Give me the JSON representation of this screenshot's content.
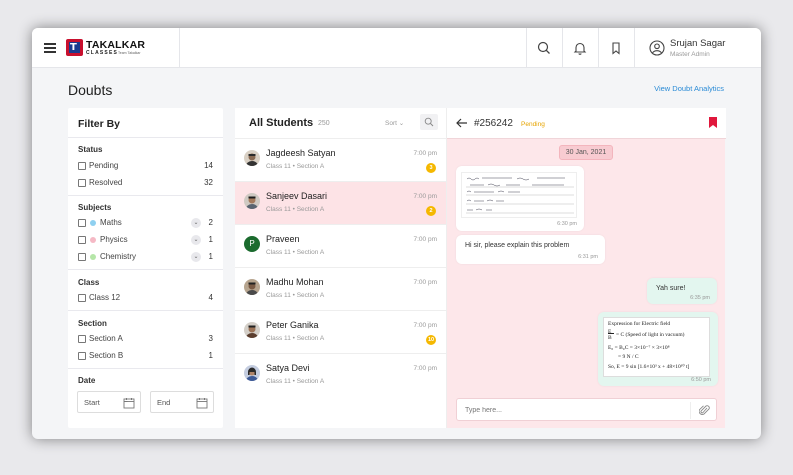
{
  "brand": {
    "name": "TAKALKAR",
    "subtitle": "CLASSES",
    "tagline": "Team Takalkar",
    "mark": "T"
  },
  "user": {
    "name": "Srujan Sagar",
    "role": "Master Admin"
  },
  "page": {
    "title": "Doubts",
    "analytics_link": "View Doubt Analytics"
  },
  "filter": {
    "title": "Filter By",
    "status": {
      "title": "Status",
      "items": [
        {
          "label": "Pending",
          "count": "14"
        },
        {
          "label": "Resolved",
          "count": "32"
        }
      ]
    },
    "subjects": {
      "title": "Subjects",
      "items": [
        {
          "label": "Maths",
          "count": "2",
          "color": "#8fd0f0"
        },
        {
          "label": "Physics",
          "count": "1",
          "color": "#f5b9c5"
        },
        {
          "label": "Chemistry",
          "count": "1",
          "color": "#b5e6a8"
        }
      ]
    },
    "class": {
      "title": "Class",
      "items": [
        {
          "label": "Class 12",
          "count": "4"
        }
      ]
    },
    "section": {
      "title": "Section",
      "items": [
        {
          "label": "Section A",
          "count": "3"
        },
        {
          "label": "Section B",
          "count": "1"
        }
      ]
    },
    "date": {
      "title": "Date",
      "start": "Start",
      "end": "End"
    }
  },
  "students": {
    "title": "All Students",
    "count": "250",
    "sort": "Sort",
    "items": [
      {
        "name": "Jagdeesh Satyan",
        "sub": "Class 11 • Section A",
        "time": "7:00 pm",
        "badge": "3"
      },
      {
        "name": "Sanjeev Dasari",
        "sub": "Class 11 • Section A",
        "time": "7:00 pm",
        "badge": "2"
      },
      {
        "name": "Praveen",
        "sub": "Class 11 • Section A",
        "time": "7:00 pm",
        "badge": "",
        "initial": "P"
      },
      {
        "name": "Madhu Mohan",
        "sub": "Class 11 • Section A",
        "time": "7:00 pm",
        "badge": ""
      },
      {
        "name": "Peter Ganika",
        "sub": "Class 11 • Section A",
        "time": "7:00 pm",
        "badge": "10"
      },
      {
        "name": "Satya Devi",
        "sub": "Class 11 • Section A",
        "time": "7:00 pm",
        "badge": ""
      }
    ]
  },
  "chat": {
    "ticket": "#256242",
    "status": "Pending",
    "date": "30 Jan, 2021",
    "messages": [
      {
        "text": "",
        "time": "6:30 pm"
      },
      {
        "text": "Hi sir, please explain this problem",
        "time": "6:31 pm"
      },
      {
        "text": "Yah sure!",
        "time": "6:35 pm"
      },
      {
        "text": "",
        "time": "6:50 pm"
      }
    ],
    "solution": {
      "title": "Expression for Electric field",
      "l1a": "E",
      "l1b": "B",
      "l1c": "= C (Speed of light in vacuum)",
      "l2": "E₀ = B₀C = 3×10⁻⁷ × 3×10⁸",
      "l3": "= 9 N / C",
      "l4": "So,  E = 9 sin [1.6×10³ x + 48×10¹⁰ t]"
    },
    "input_placeholder": "Type here..."
  },
  "colors": {
    "accent": "#2a8bd6",
    "pending": "#e6a400",
    "badge": "#f5b800",
    "active_row": "#fde3e6",
    "bookmark": "#e0173c"
  }
}
